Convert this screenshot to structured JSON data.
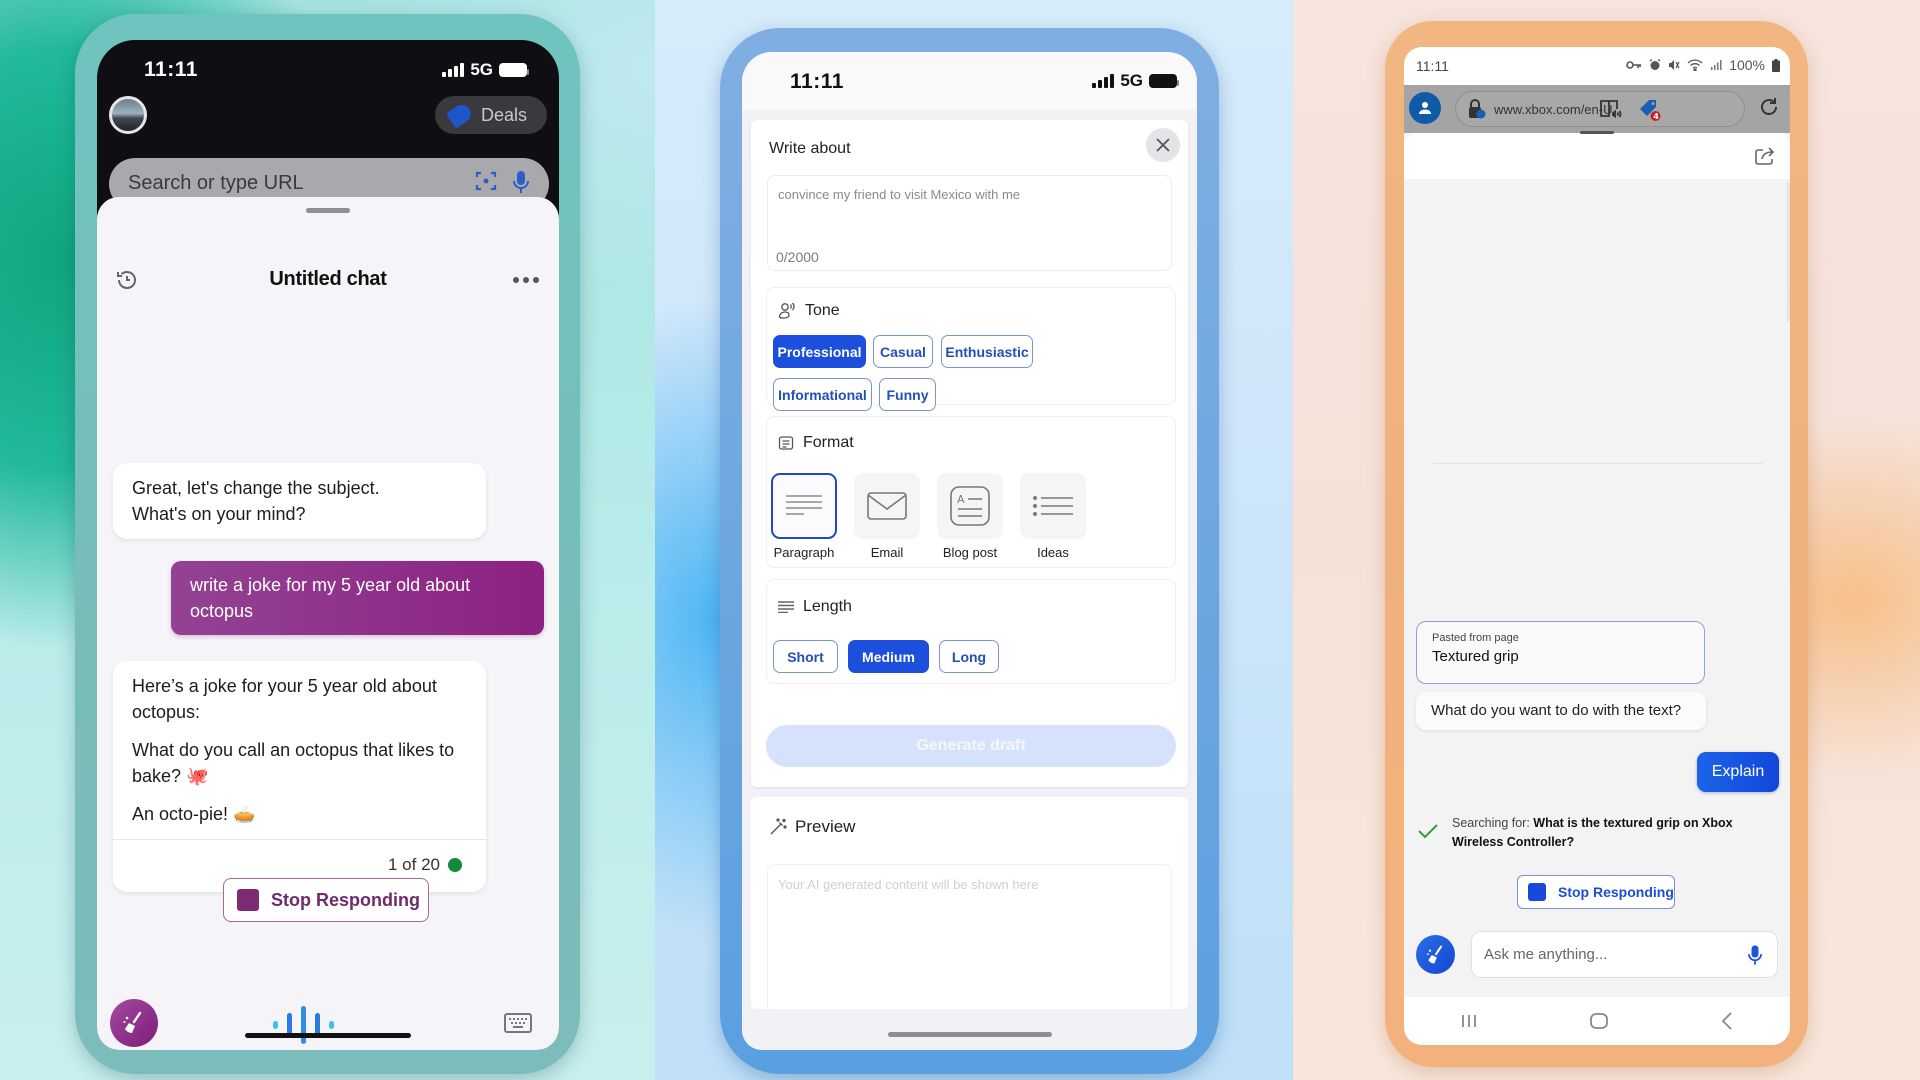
{
  "phones": {
    "left": {
      "status": {
        "time": "11:11",
        "network": "5G"
      },
      "browser": {
        "deals_label": "Deals",
        "search_placeholder": "Search or type URL"
      },
      "chat": {
        "title": "Untitled chat",
        "messages": [
          {
            "role": "assistant",
            "lines": [
              "Great, let's change the subject.",
              "What's on your mind?"
            ]
          },
          {
            "role": "user",
            "text": "write a joke for my 5 year old about octopus"
          },
          {
            "role": "assistant",
            "paragraphs": [
              "Here’s a joke for your 5 year old about octopus:",
              "What do you call an octopus that likes to bake? 🐙",
              "An octo-pie! 🥧"
            ],
            "counter": "1 of 20"
          }
        ],
        "stop_label": "Stop Responding"
      },
      "colors": {
        "accent": "#8c2182",
        "stop": "#7b2c73",
        "status_dot": "#138a3b"
      }
    },
    "middle": {
      "status": {
        "time": "11:11",
        "network": "5G"
      },
      "compose": {
        "write_about_label": "Write about",
        "write_about_placeholder": "convince my friend to visit Mexico with me",
        "char_count": "0/2000",
        "tone": {
          "label": "Tone",
          "options": [
            "Professional",
            "Casual",
            "Enthusiastic",
            "Informational",
            "Funny"
          ],
          "selected": "Professional"
        },
        "format": {
          "label": "Format",
          "options": [
            "Paragraph",
            "Email",
            "Blog post",
            "Ideas"
          ],
          "selected": "Paragraph"
        },
        "length": {
          "label": "Length",
          "options": [
            "Short",
            "Medium",
            "Long"
          ],
          "selected": "Medium"
        },
        "generate_label": "Generate draft",
        "preview_label": "Preview",
        "preview_placeholder": "Your AI generated content will be shown here"
      },
      "colors": {
        "accent": "#1b4fdc"
      }
    },
    "right": {
      "status": {
        "time": "11:11",
        "battery": "100%"
      },
      "browser": {
        "url": "www.xbox.com/en-U",
        "deals_badge": "4"
      },
      "chat": {
        "pasted_label": "Pasted from page",
        "pasted_value": "Textured grip",
        "question": "What do you want to do with the text?",
        "user_reply": "Explain",
        "searching_prefix": "Searching for: ",
        "searching_query": "What is the textured grip on Xbox Wireless Controller?",
        "stop_label": "Stop Responding",
        "input_placeholder": "Ask me anything..."
      },
      "colors": {
        "accent": "#1b4fdc",
        "check": "#2e9e44"
      }
    }
  }
}
